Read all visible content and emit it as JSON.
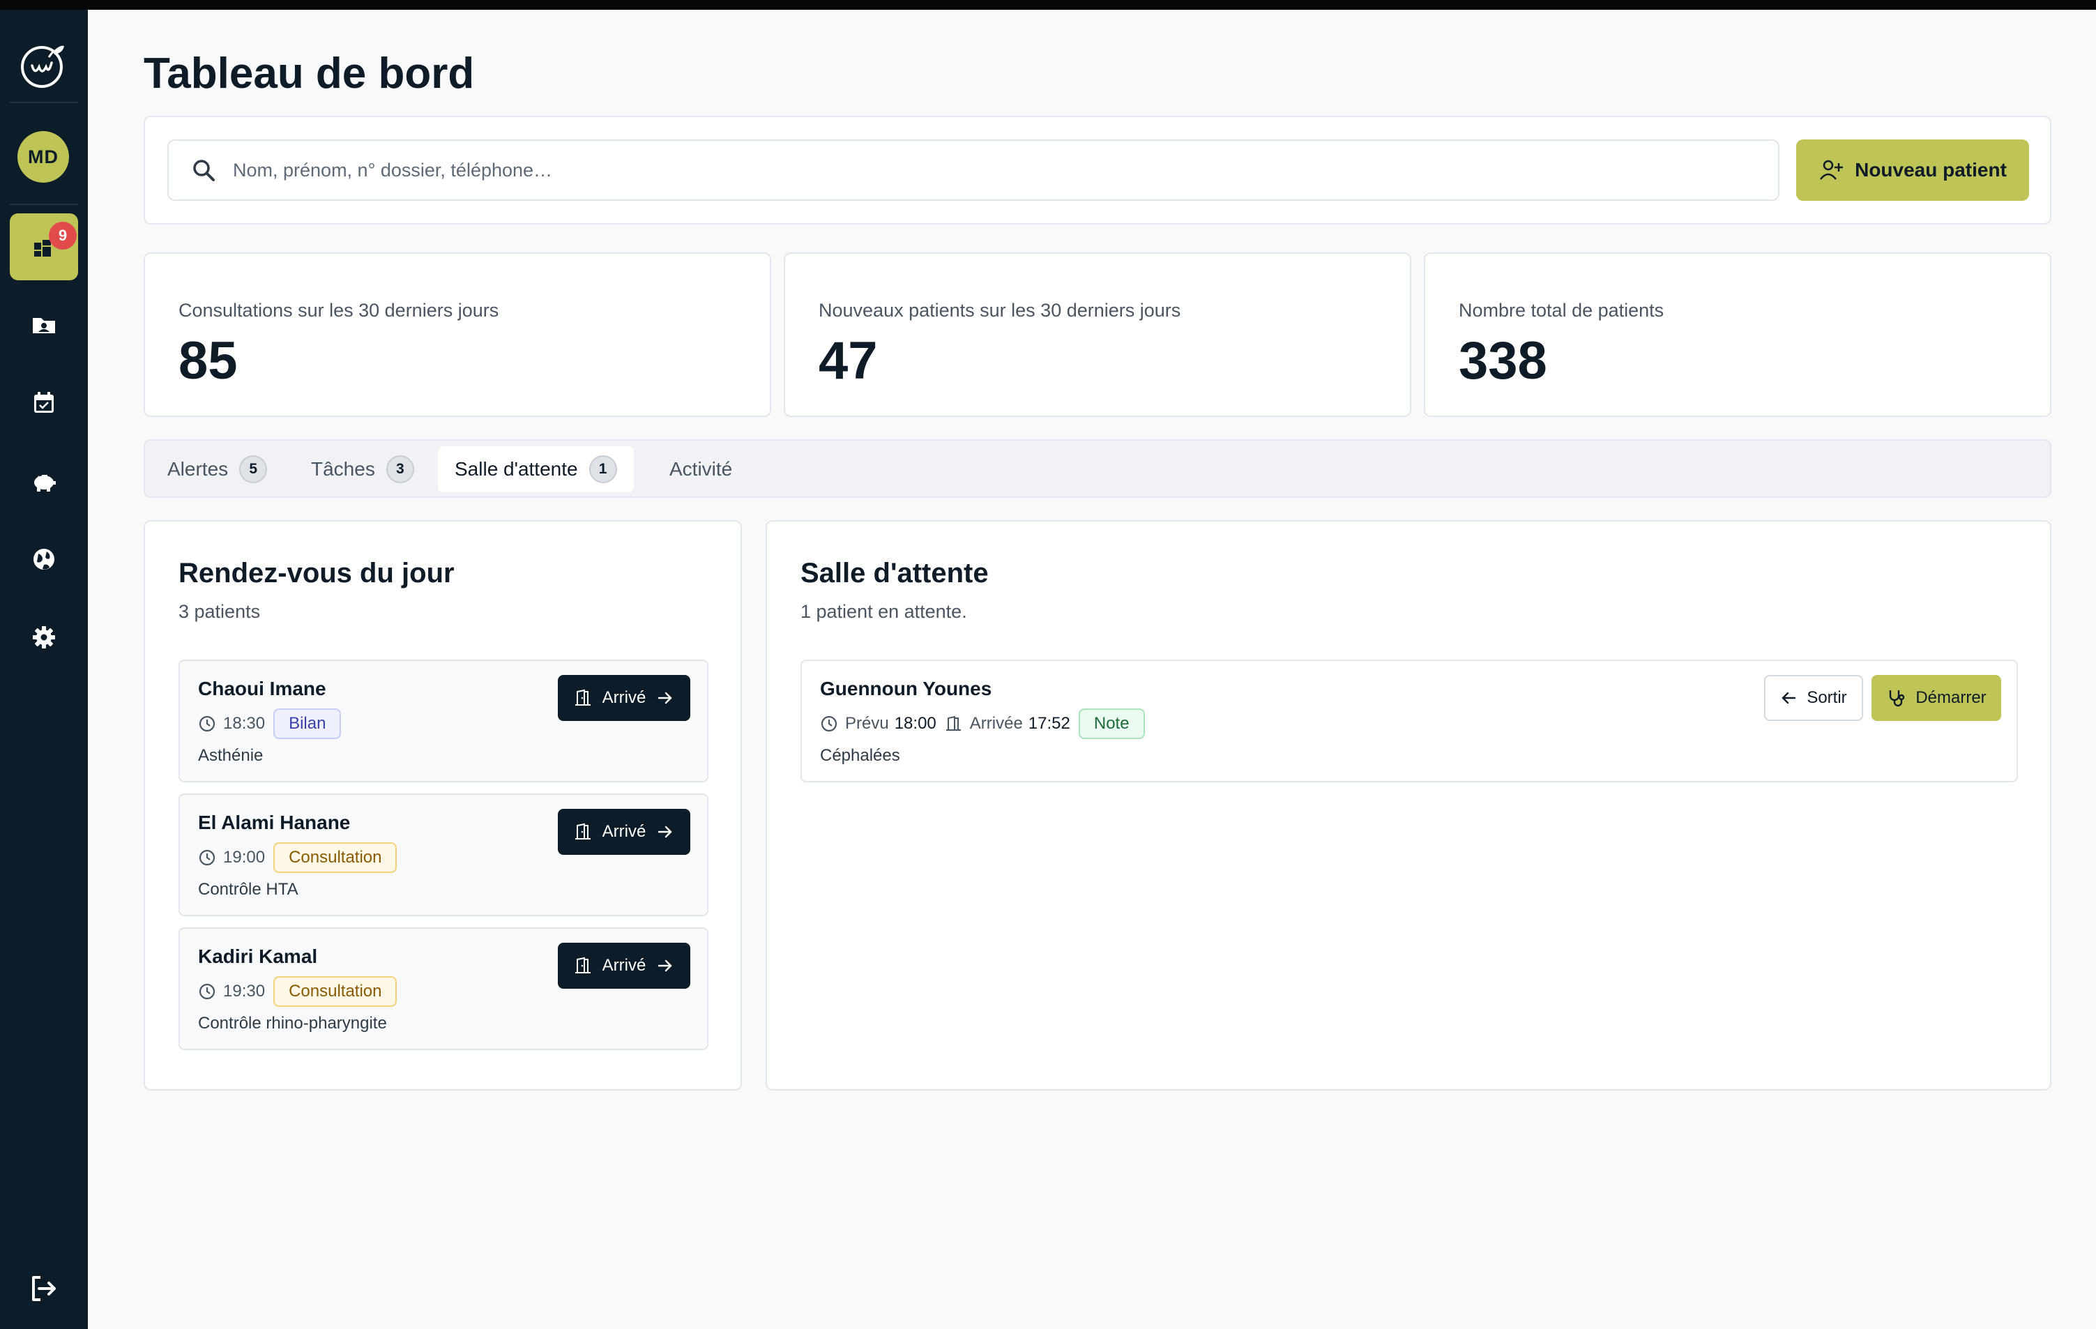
{
  "sidebar": {
    "avatar_initials": "MD",
    "notifications_count": "9",
    "items": [
      {
        "name": "dashboard",
        "icon": "dashboard-icon"
      },
      {
        "name": "patients",
        "icon": "patient-folder-icon"
      },
      {
        "name": "calendar",
        "icon": "calendar-check-icon"
      },
      {
        "name": "finance",
        "icon": "piggy-bank-icon"
      },
      {
        "name": "web",
        "icon": "globe-icon"
      },
      {
        "name": "settings",
        "icon": "gear-icon"
      }
    ],
    "logout_icon": "logout-icon"
  },
  "page": {
    "title": "Tableau de bord"
  },
  "search": {
    "placeholder": "Nom, prénom, n° dossier, téléphone…",
    "new_patient_label": "Nouveau patient"
  },
  "stats": [
    {
      "label": "Consultations sur les 30 derniers jours",
      "value": "85"
    },
    {
      "label": "Nouveaux patients sur les 30 derniers jours",
      "value": "47"
    },
    {
      "label": "Nombre total de patients",
      "value": "338"
    }
  ],
  "tabs": [
    {
      "label": "Alertes",
      "count": "5"
    },
    {
      "label": "Tâches",
      "count": "3"
    },
    {
      "label": "Salle d'attente",
      "count": "1",
      "active": true
    },
    {
      "label": "Activité"
    }
  ],
  "appointments": {
    "title": "Rendez-vous du jour",
    "subtitle": "3 patients",
    "arrive_label": "Arrivé",
    "items": [
      {
        "name": "Chaoui Imane",
        "time": "18:30",
        "type": "Bilan",
        "reason": "Asthénie"
      },
      {
        "name": "El Alami Hanane",
        "time": "19:00",
        "type": "Consultation",
        "reason": "Contrôle HTA"
      },
      {
        "name": "Kadiri Kamal",
        "time": "19:30",
        "type": "Consultation",
        "reason": "Contrôle rhino-pharyngite"
      }
    ]
  },
  "waiting_room": {
    "title": "Salle d'attente",
    "subtitle": "1 patient en attente.",
    "sortir_label": "Sortir",
    "start_label": "Démarrer",
    "items": [
      {
        "name": "Guennoun Younes",
        "planned_label": "Prévu",
        "planned": "18:00",
        "arrived_label": "Arrivée",
        "arrived": "17:52",
        "tag": "Note",
        "reason": "Céphalées"
      }
    ]
  },
  "colors": {
    "sidebar": "#0d1c29",
    "accent": "#bfc457",
    "notification": "#e24b4b"
  }
}
